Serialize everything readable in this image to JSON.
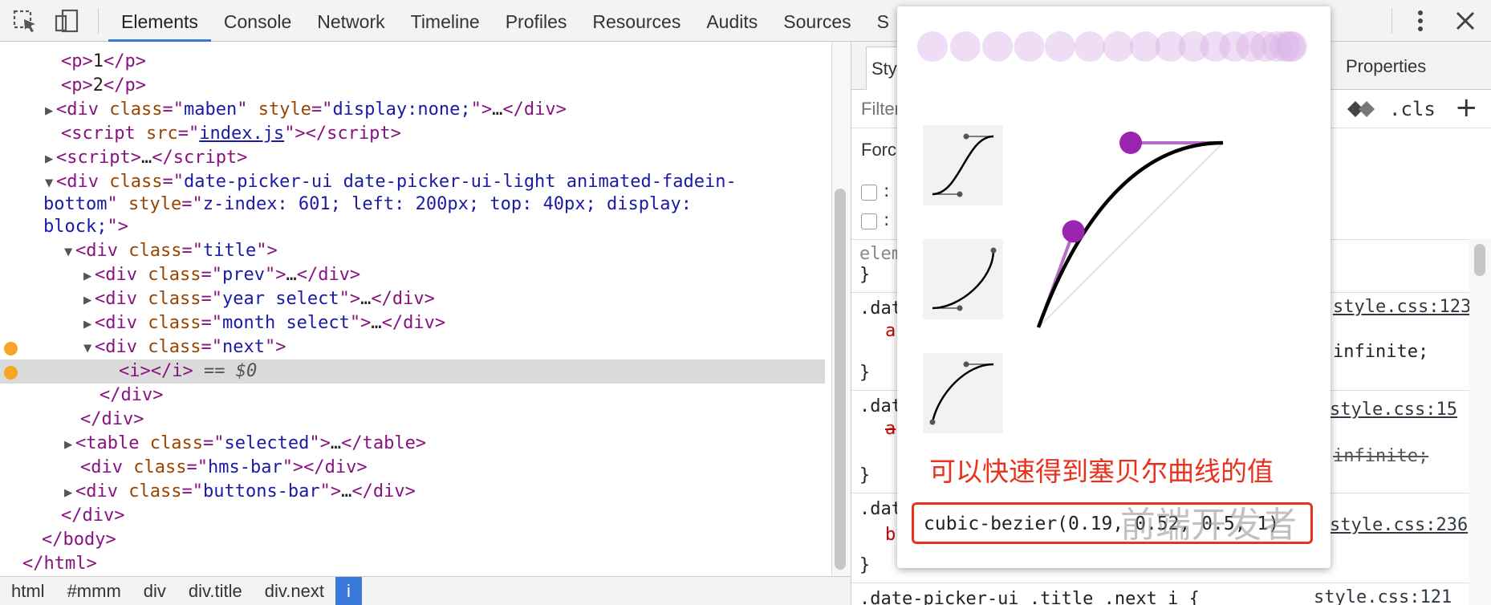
{
  "toolbar": {
    "tabs": [
      "Elements",
      "Console",
      "Network",
      "Timeline",
      "Profiles",
      "Resources",
      "Audits",
      "Sources"
    ],
    "active_tab": "Elements",
    "overflow_fragment": "S",
    "icons": [
      "inspect-element-icon",
      "device-mode-icon",
      "more-vertical-icon",
      "close-icon"
    ]
  },
  "dom_tree": {
    "lines": [
      {
        "text1": "1",
        "text2": "2"
      },
      {
        "maben_class": "maben",
        "maben_style": "display:none;"
      },
      {
        "script_src": "index.js"
      }
    ],
    "p1": "1",
    "p2": "2",
    "maben_class": "maben",
    "maben_style": "display:none;",
    "script_src": "index.js",
    "datepicker_class_a": "date-picker-ui date-picker-ui-light animated-fadein-",
    "datepicker_class_b": "bottom",
    "datepicker_style_a": "z-index: 601; left: 200px; top: 40px; display:",
    "datepicker_style_b": "block;",
    "title_class": "title",
    "prev_class": "prev",
    "year_class": "year select",
    "month_class": "month select",
    "next_class": "next",
    "selected_marker": "== $0",
    "table_class": "selected",
    "hms_class": "hms-bar",
    "buttons_class": "buttons-bar"
  },
  "breadcrumb": [
    "html",
    "#mmm",
    "div",
    "div.title",
    "div.next",
    "i"
  ],
  "styles": {
    "tabs": [
      "Styl",
      "Properties"
    ],
    "filter_placeholder": "Filter",
    "cls_label": ".cls",
    "plus_label": "+",
    "force_label": "Forc",
    "checkbox_labels": [
      ":",
      ":"
    ],
    "rule1_selector": "eleme",
    "rule1_close": "}",
    "rule2_selector": ".dat",
    "rule2_prop": "a",
    "rule2_value": "infinite;",
    "rule2_source": "style.css:123",
    "rule2_close": "}",
    "rule3_selector": ".dat",
    "rule3_prop": "a",
    "rule3_value": "infinite;",
    "rule3_source": "style.css:15",
    "rule3_close": "}",
    "rule4_selector": ".dat",
    "rule4_prop": "b",
    "rule4_source": "style.css:236",
    "rule4_close": "}",
    "rule5_selector": ".date-picker-ui .title .next i {",
    "rule5_source": "style.css:121"
  },
  "bezier_editor": {
    "caption": "可以快速得到塞贝尔曲线的值",
    "value": "cubic-bezier(0.19, 0.52, 0.5, 1)",
    "handles": {
      "p1": [
        0.19,
        0.52
      ],
      "p2": [
        0.5,
        1
      ]
    },
    "colors": {
      "curve": "#000000",
      "handle": "#9a25ae",
      "preview_dot": "#d9b3e6"
    }
  },
  "watermark": "前端开发者",
  "colors": {
    "accent": "#3879d9",
    "tag": "#881280",
    "attr_name": "#994500",
    "attr_value": "#1a1aa6",
    "highlight_red": "#e8321e",
    "dom_marker": "#f5a623"
  }
}
